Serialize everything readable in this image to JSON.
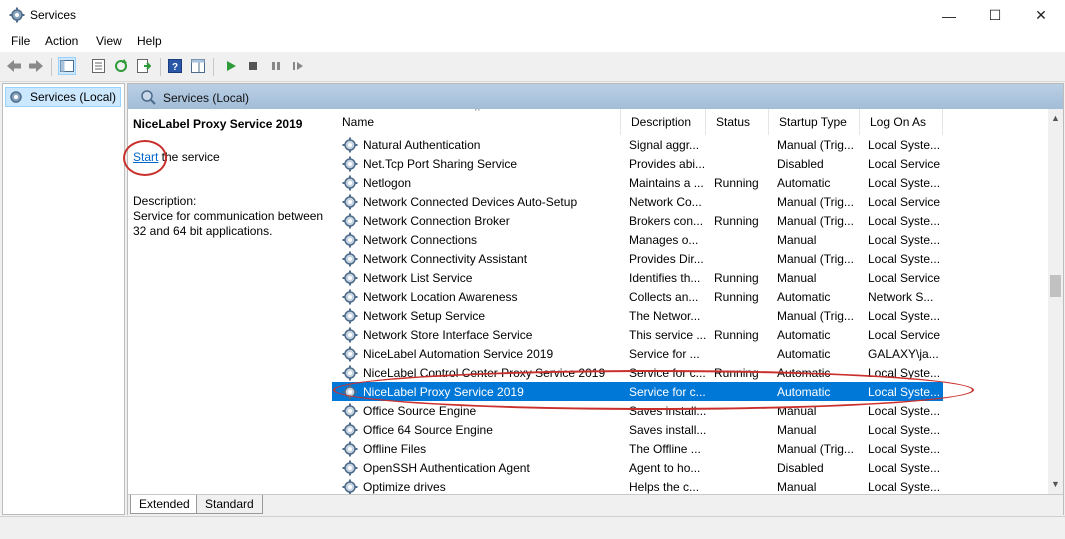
{
  "window": {
    "title": "Services",
    "minimize": "—",
    "maximize": "☐",
    "close": "✕"
  },
  "menu": [
    "File",
    "Action",
    "View",
    "Help"
  ],
  "tree": {
    "root_label": "Services (Local)"
  },
  "content_header": "Services (Local)",
  "detail": {
    "service_name": "NiceLabel Proxy Service 2019",
    "start_link": "Start",
    "start_suffix": " the service",
    "description_label": "Description:",
    "description_text": "Service for communication between 32 and 64 bit applications."
  },
  "columns": [
    "Name",
    "Description",
    "Status",
    "Startup Type",
    "Log On As"
  ],
  "rows": [
    {
      "name": "Natural Authentication",
      "desc": "Signal aggr...",
      "status": "",
      "startup": "Manual (Trig...",
      "logon": "Local Syste..."
    },
    {
      "name": "Net.Tcp Port Sharing Service",
      "desc": "Provides abi...",
      "status": "",
      "startup": "Disabled",
      "logon": "Local Service"
    },
    {
      "name": "Netlogon",
      "desc": "Maintains a ...",
      "status": "Running",
      "startup": "Automatic",
      "logon": "Local Syste..."
    },
    {
      "name": "Network Connected Devices Auto-Setup",
      "desc": "Network Co...",
      "status": "",
      "startup": "Manual (Trig...",
      "logon": "Local Service"
    },
    {
      "name": "Network Connection Broker",
      "desc": "Brokers con...",
      "status": "Running",
      "startup": "Manual (Trig...",
      "logon": "Local Syste..."
    },
    {
      "name": "Network Connections",
      "desc": "Manages o...",
      "status": "",
      "startup": "Manual",
      "logon": "Local Syste..."
    },
    {
      "name": "Network Connectivity Assistant",
      "desc": "Provides Dir...",
      "status": "",
      "startup": "Manual (Trig...",
      "logon": "Local Syste..."
    },
    {
      "name": "Network List Service",
      "desc": "Identifies th...",
      "status": "Running",
      "startup": "Manual",
      "logon": "Local Service"
    },
    {
      "name": "Network Location Awareness",
      "desc": "Collects an...",
      "status": "Running",
      "startup": "Automatic",
      "logon": "Network S..."
    },
    {
      "name": "Network Setup Service",
      "desc": "The Networ...",
      "status": "",
      "startup": "Manual (Trig...",
      "logon": "Local Syste..."
    },
    {
      "name": "Network Store Interface Service",
      "desc": "This service ...",
      "status": "Running",
      "startup": "Automatic",
      "logon": "Local Service"
    },
    {
      "name": "NiceLabel Automation Service 2019",
      "desc": "Service for ...",
      "status": "",
      "startup": "Automatic",
      "logon": "GALAXY\\ja..."
    },
    {
      "name": "NiceLabel Control Center Proxy Service 2019",
      "desc": "Service for c...",
      "status": "Running",
      "startup": "Automatic",
      "logon": "Local Syste..."
    },
    {
      "name": "NiceLabel Proxy Service 2019",
      "desc": "Service for c...",
      "status": "",
      "startup": "Automatic",
      "logon": "Local Syste...",
      "selected": true
    },
    {
      "name": "Office  Source Engine",
      "desc": "Saves install...",
      "status": "",
      "startup": "Manual",
      "logon": "Local Syste..."
    },
    {
      "name": "Office 64 Source Engine",
      "desc": "Saves install...",
      "status": "",
      "startup": "Manual",
      "logon": "Local Syste..."
    },
    {
      "name": "Offline Files",
      "desc": "The Offline ...",
      "status": "",
      "startup": "Manual (Trig...",
      "logon": "Local Syste..."
    },
    {
      "name": "OpenSSH Authentication Agent",
      "desc": "Agent to ho...",
      "status": "",
      "startup": "Disabled",
      "logon": "Local Syste..."
    },
    {
      "name": "Optimize drives",
      "desc": "Helps the c...",
      "status": "",
      "startup": "Manual",
      "logon": "Local Syste..."
    }
  ],
  "tabs": [
    "Extended",
    "Standard"
  ],
  "colors": {
    "selection": "#0078d7",
    "link": "#0066cc",
    "annotation": "#c9302c"
  }
}
